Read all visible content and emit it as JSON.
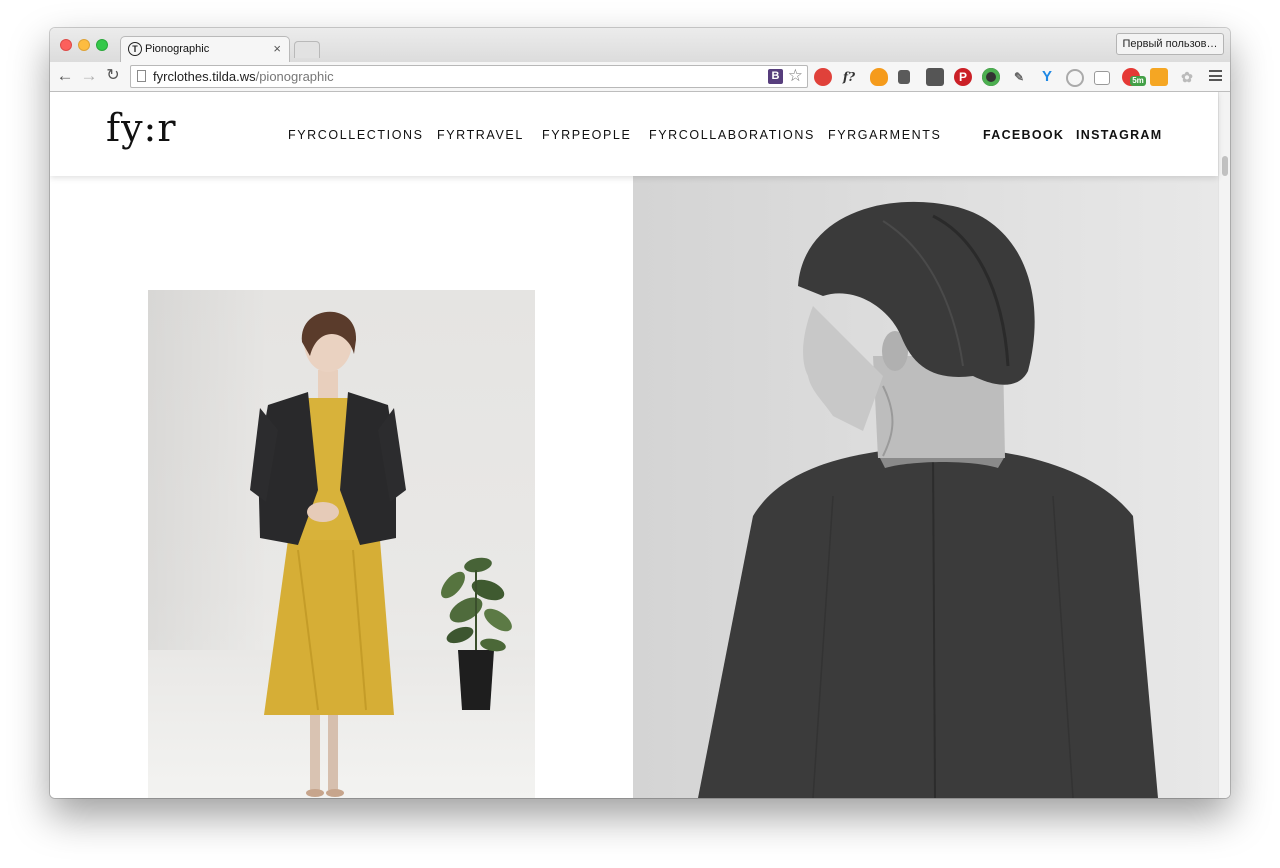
{
  "browser": {
    "tab_title": "Pionographic",
    "tab_close": "×",
    "profile_button": "Первый пользов…",
    "url_host": "fyrclothes.tilda.ws",
    "url_path": "/pionographic",
    "extensions": [
      "bootstrap-icon",
      "star-icon",
      "ublock-icon",
      "font-finder-icon",
      "fire-icon",
      "evernote-icon",
      "pocket-icon",
      "pinterest-icon",
      "color-picker-icon",
      "eyedropper-icon",
      "y-icon",
      "refresh-icon",
      "reader-icon",
      "counter-icon",
      "analytics-icon",
      "paw-icon",
      "menu-icon"
    ],
    "counter_badge": "5m"
  },
  "site": {
    "logo": "fy:r",
    "nav": [
      {
        "label": "FYRCOLLECTIONS"
      },
      {
        "label": "FYRTRAVEL"
      },
      {
        "label": "FYRPEOPLE"
      },
      {
        "label": "FYRCOLLABORATIONS"
      },
      {
        "label": "FYRGARMENTS"
      }
    ],
    "social": [
      {
        "label": "FACEBOOK"
      },
      {
        "label": "INSTAGRAM"
      }
    ]
  },
  "colors": {
    "dress_yellow": "#d8b23a",
    "jacket_dark": "#2a2a2c",
    "bw_sweater": "#3a3a3a",
    "hair_brown": "#5a3b2b"
  }
}
